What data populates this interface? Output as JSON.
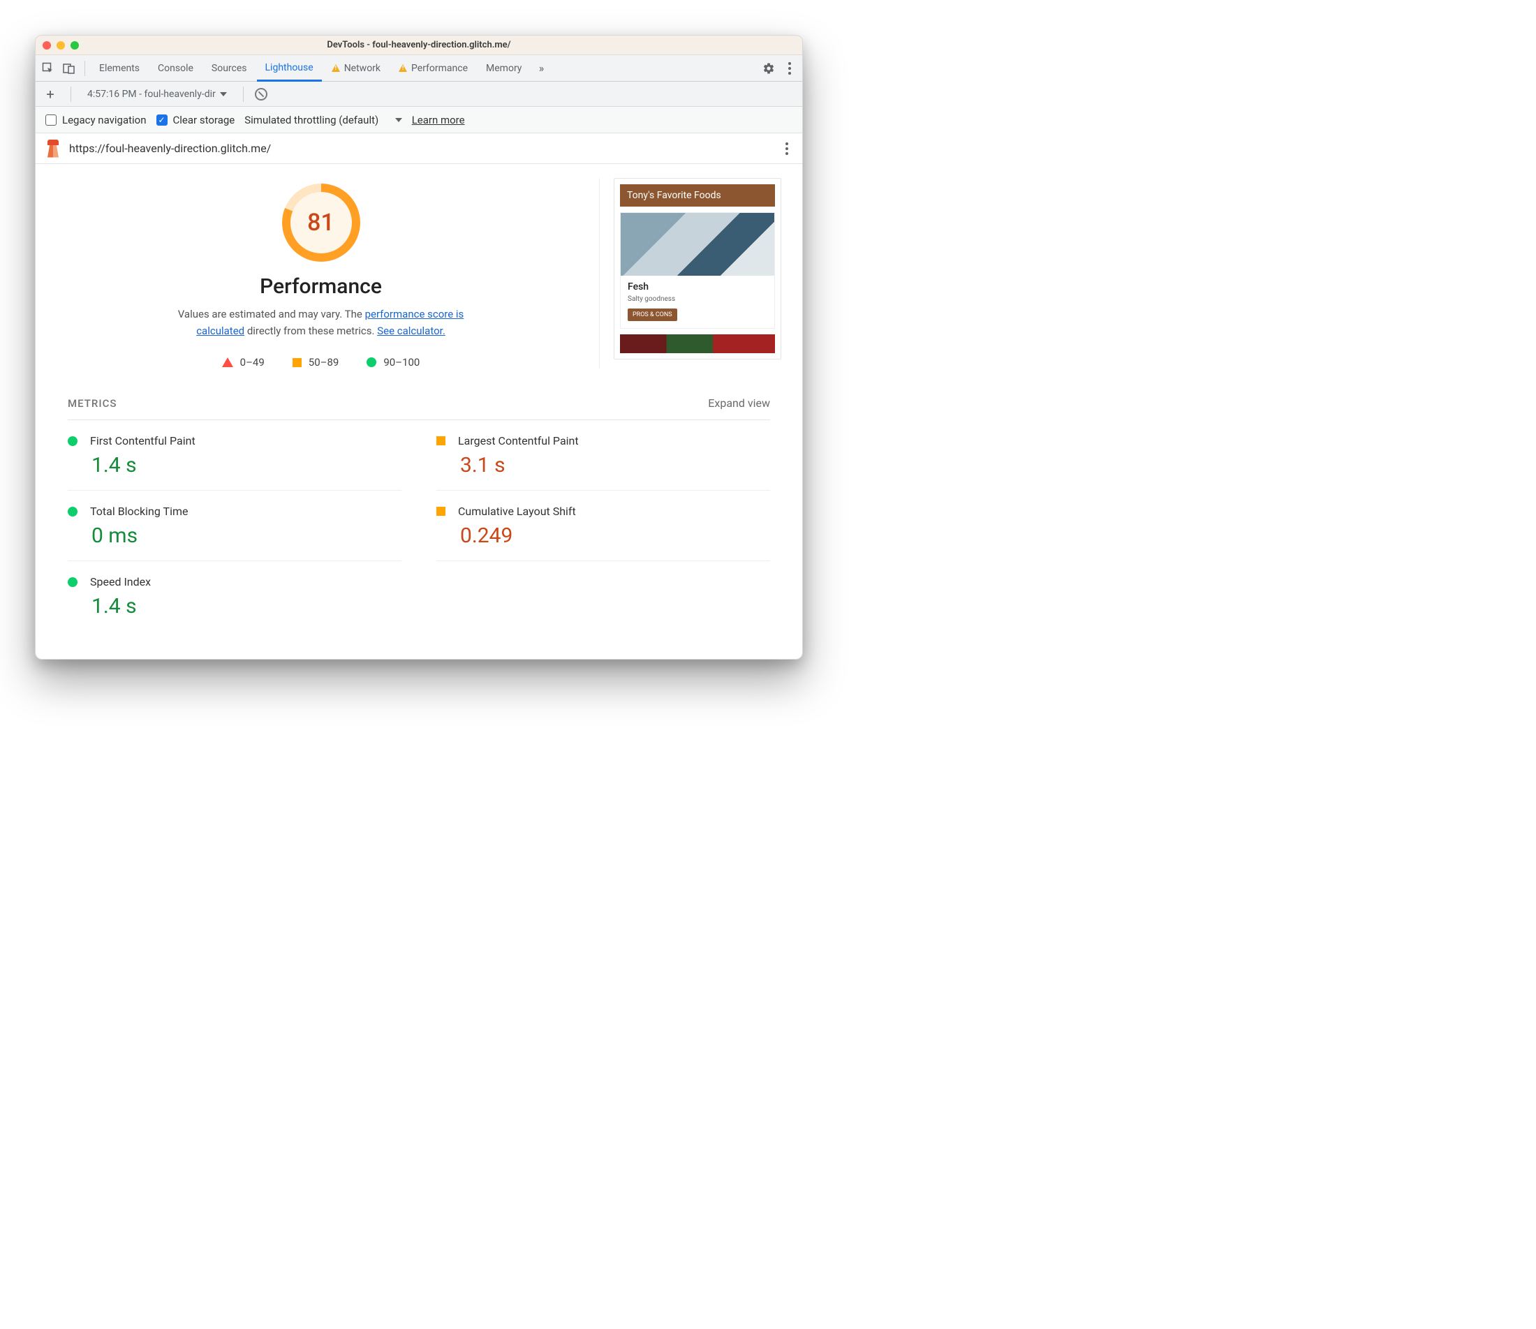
{
  "window": {
    "title": "DevTools - foul-heavenly-direction.glitch.me/"
  },
  "tabs": {
    "elements": "Elements",
    "console": "Console",
    "sources": "Sources",
    "lighthouse": "Lighthouse",
    "network": "Network",
    "performance": "Performance",
    "memory": "Memory"
  },
  "secondbar": {
    "report_label": "4:57:16 PM - foul-heavenly-dir"
  },
  "options": {
    "legacy": "Legacy navigation",
    "clear": "Clear storage",
    "throttle": "Simulated throttling (default)",
    "learn": "Learn more"
  },
  "urlbar": {
    "url": "https://foul-heavenly-direction.glitch.me/"
  },
  "gauge": {
    "score": "81",
    "heading": "Performance"
  },
  "desc": {
    "p1": "Values are estimated and may vary. The ",
    "l1": "performance score is calculated",
    "p2": " directly from these metrics. ",
    "l2": "See calculator."
  },
  "legend": {
    "r": "0–49",
    "o": "50–89",
    "g": "90–100"
  },
  "preview": {
    "header": "Tony's Favorite Foods",
    "card_title": "Fesh",
    "card_sub": "Salty goodness",
    "card_btn": "PROS & CONS"
  },
  "metrics": {
    "title": "METRICS",
    "expand": "Expand view",
    "items": [
      {
        "label": "First Contentful Paint",
        "value": "1.4 s",
        "status": "g"
      },
      {
        "label": "Largest Contentful Paint",
        "value": "3.1 s",
        "status": "o"
      },
      {
        "label": "Total Blocking Time",
        "value": "0 ms",
        "status": "g"
      },
      {
        "label": "Cumulative Layout Shift",
        "value": "0.249",
        "status": "o"
      },
      {
        "label": "Speed Index",
        "value": "1.4 s",
        "status": "g"
      }
    ]
  },
  "chart_data": {
    "type": "gauge",
    "title": "Performance",
    "value": 81,
    "range": [
      0,
      100
    ],
    "bands": [
      {
        "label": "0–49",
        "color": "#ff4e42"
      },
      {
        "label": "50–89",
        "color": "#ffa400"
      },
      {
        "label": "90–100",
        "color": "#0cce6b"
      }
    ],
    "metrics": [
      {
        "name": "First Contentful Paint",
        "value": "1.4 s",
        "status": "pass"
      },
      {
        "name": "Largest Contentful Paint",
        "value": "3.1 s",
        "status": "average"
      },
      {
        "name": "Total Blocking Time",
        "value": "0 ms",
        "status": "pass"
      },
      {
        "name": "Cumulative Layout Shift",
        "value": "0.249",
        "status": "average"
      },
      {
        "name": "Speed Index",
        "value": "1.4 s",
        "status": "pass"
      }
    ]
  }
}
